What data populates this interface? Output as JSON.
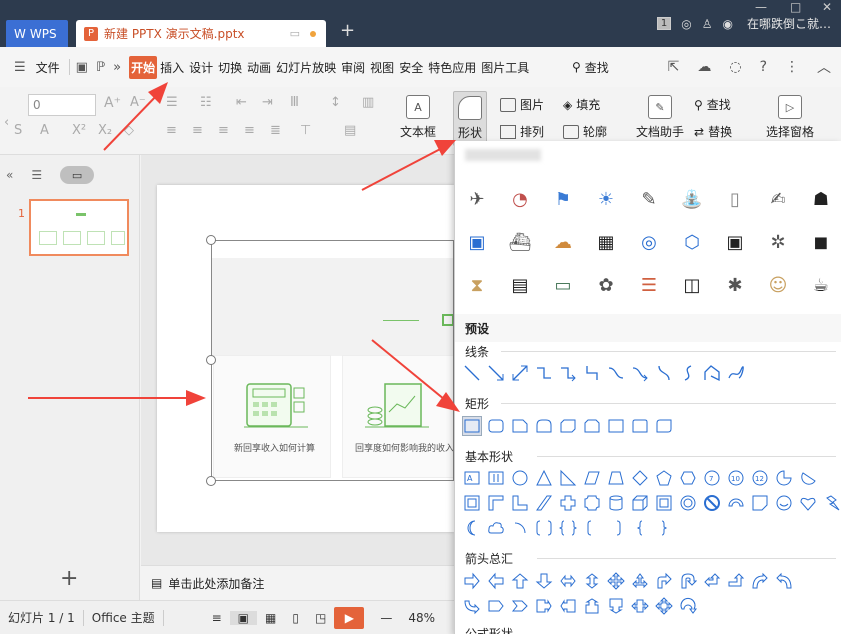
{
  "titlebar": {
    "wps_label": "WPS",
    "doc_tab": "新建 PPTX 演示文稿.pptx",
    "badge": "1",
    "user_text": "在哪跌倒こ就…"
  },
  "menubar": {
    "file": "文件",
    "tabs": [
      "开始",
      "插入",
      "设计",
      "切换",
      "动画",
      "幻灯片放映",
      "审阅",
      "视图",
      "安全",
      "特色应用",
      "图片工具"
    ],
    "active_tab": "开始",
    "search": "查找"
  },
  "ribbon": {
    "font_size": "0",
    "textbox": "文本框",
    "shape": "形状",
    "picture": "图片",
    "fill": "填充",
    "arrange": "排列",
    "outline": "轮廓",
    "doc_helper": "文档助手",
    "find": "查找",
    "replace": "替换",
    "selection_pane": "选择窗格"
  },
  "left_panel": {
    "slide_number": "1",
    "add_slide": "+"
  },
  "slide": {
    "card1_text": "新回享收入如何计算",
    "card2_text": "回享度如何影响我的收入"
  },
  "notes": {
    "placeholder": "单击此处添加备注"
  },
  "statusbar": {
    "slide_count": "幻灯片 1 / 1",
    "theme": "Office 主题",
    "zoom": "48%"
  },
  "shapes_dropdown": {
    "icon_names": [
      "satellite-icon",
      "pie-chart-icon",
      "flag-icon",
      "lightbulb-icon",
      "rocket-icon",
      "fountain-icon",
      "door-icon",
      "notepad-icon",
      "people-icon",
      "wallet-icon",
      "ship-icon",
      "cloud-sun-icon",
      "building-icon",
      "target-icon",
      "hexagon-icon",
      "contact-card-icon",
      "gear-icon",
      "bag-icon",
      "hourglass-icon",
      "sale-sign-icon",
      "presentation-icon",
      "brain-icon",
      "document-search-icon",
      "trash-icon",
      "crab-icon",
      "worker-icon",
      "cup-icon"
    ],
    "presets": "预设",
    "lines": "线条",
    "rectangles": "矩形",
    "basic_shapes": "基本形状",
    "block_arrows": "箭头总汇",
    "formula_shapes": "公式形状"
  },
  "colors": {
    "accent": "#e4633a",
    "titlebar": "#2d3b4e",
    "shape_blue": "#2a6ed1",
    "green": "#6ab85a"
  }
}
